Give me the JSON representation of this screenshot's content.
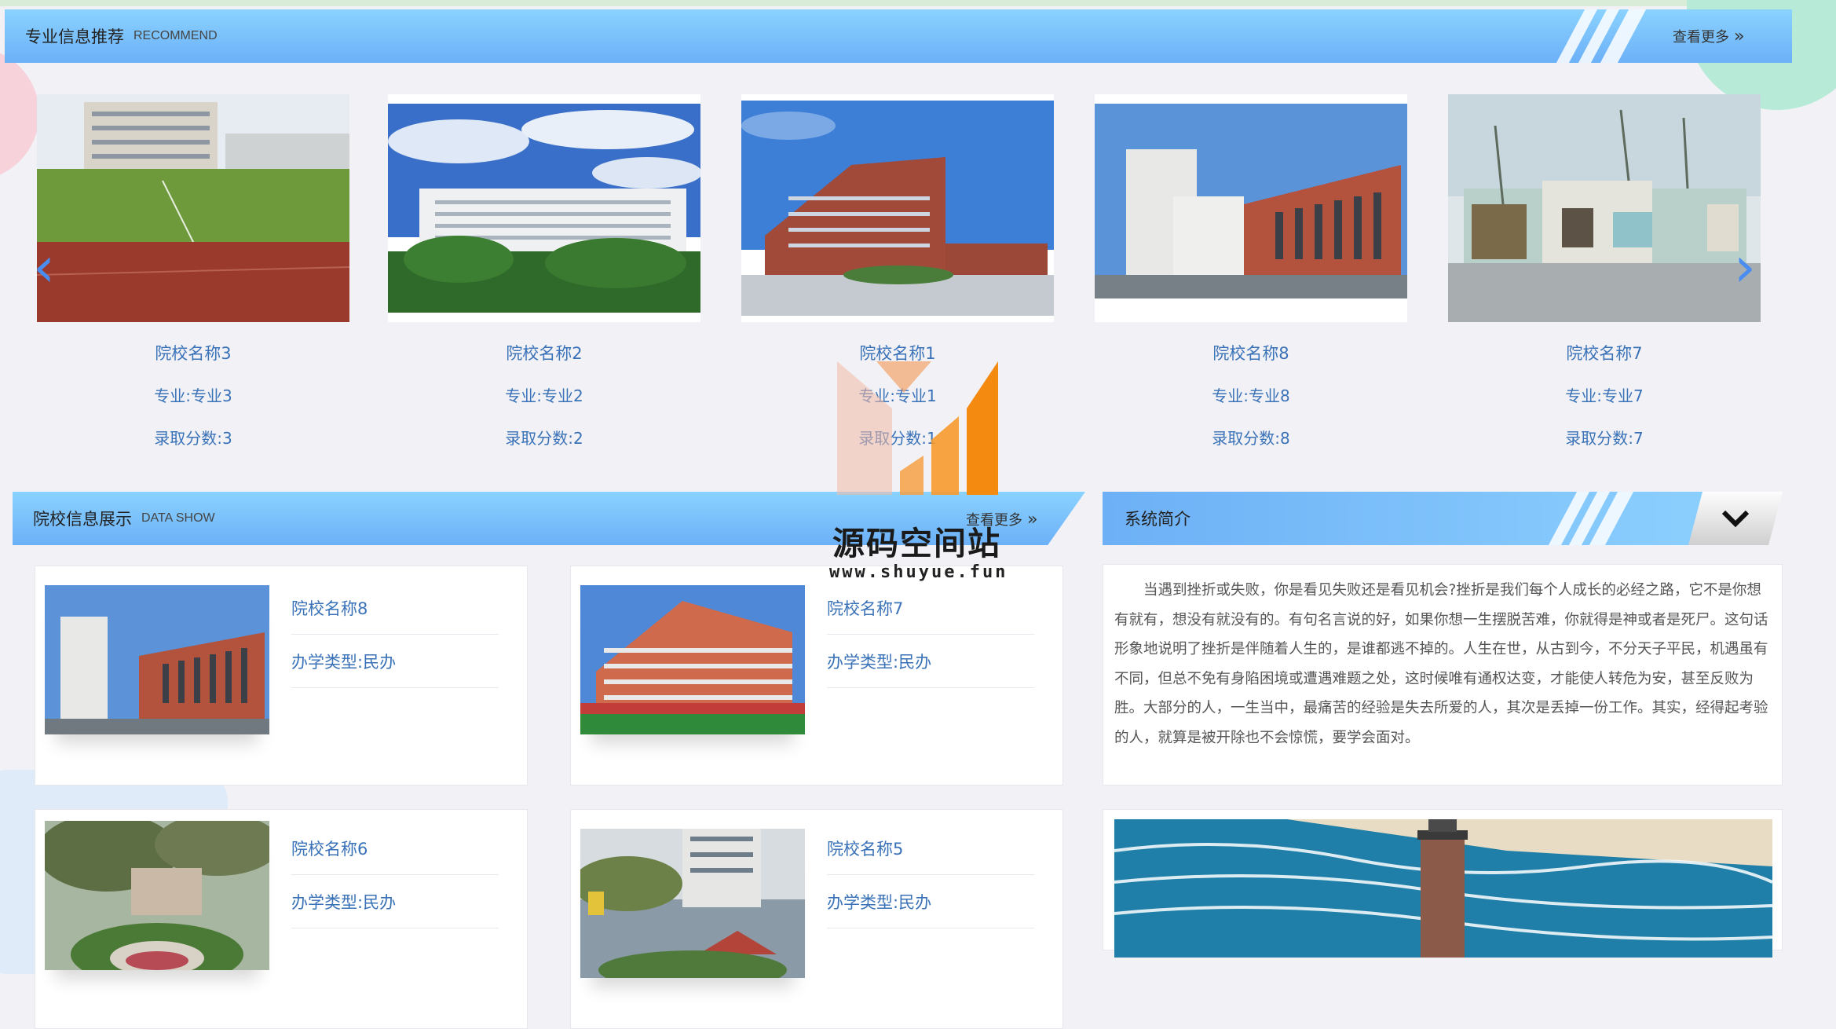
{
  "recommend": {
    "title": "专业信息推荐",
    "subtitle": "RECOMMEND",
    "more": "查看更多",
    "cards": [
      {
        "name": "院校名称3",
        "major": "专业:专业3",
        "score": "录取分数:3"
      },
      {
        "name": "院校名称2",
        "major": "专业:专业2",
        "score": "录取分数:2"
      },
      {
        "name": "院校名称1",
        "major": "专业:专业1",
        "score": "录取分数:1"
      },
      {
        "name": "院校名称8",
        "major": "专业:专业8",
        "score": "录取分数:8"
      },
      {
        "name": "院校名称7",
        "major": "专业:专业7",
        "score": "录取分数:7"
      }
    ]
  },
  "show": {
    "title": "院校信息展示",
    "subtitle": "DATA SHOW",
    "more": "查看更多",
    "cards": [
      {
        "name": "院校名称8",
        "type": "办学类型:民办"
      },
      {
        "name": "院校名称7",
        "type": "办学类型:民办"
      },
      {
        "name": "院校名称6",
        "type": "办学类型:民办"
      },
      {
        "name": "院校名称5",
        "type": "办学类型:民办"
      }
    ]
  },
  "intro": {
    "title": "系统简介",
    "text": "当遇到挫折或失败，你是看见失败还是看见机会?挫折是我们每个人成长的必经之路，它不是你想有就有，想没有就没有的。有句名言说的好，如果你想一生摆脱苦难，你就得是神或者是死尸。这句话形象地说明了挫折是伴随着人生的，是谁都逃不掉的。人生在世，从古到今，不分天子平民，机遇虽有不同，但总不免有身陷困境或遭遇难题之处，这时候唯有通权达变，才能使人转危为安，甚至反败为胜。大部分的人，一生当中，最痛苦的经验是失去所爱的人，其次是丢掉一份工作。其实，经得起考验的人，就算是被开除也不会惊慌，要学会面对。"
  },
  "watermark": {
    "title": "源码空间站",
    "url": "www.shuyue.fun"
  },
  "colors": {
    "accent": "#6cb0f7",
    "link": "#3a72b8"
  }
}
